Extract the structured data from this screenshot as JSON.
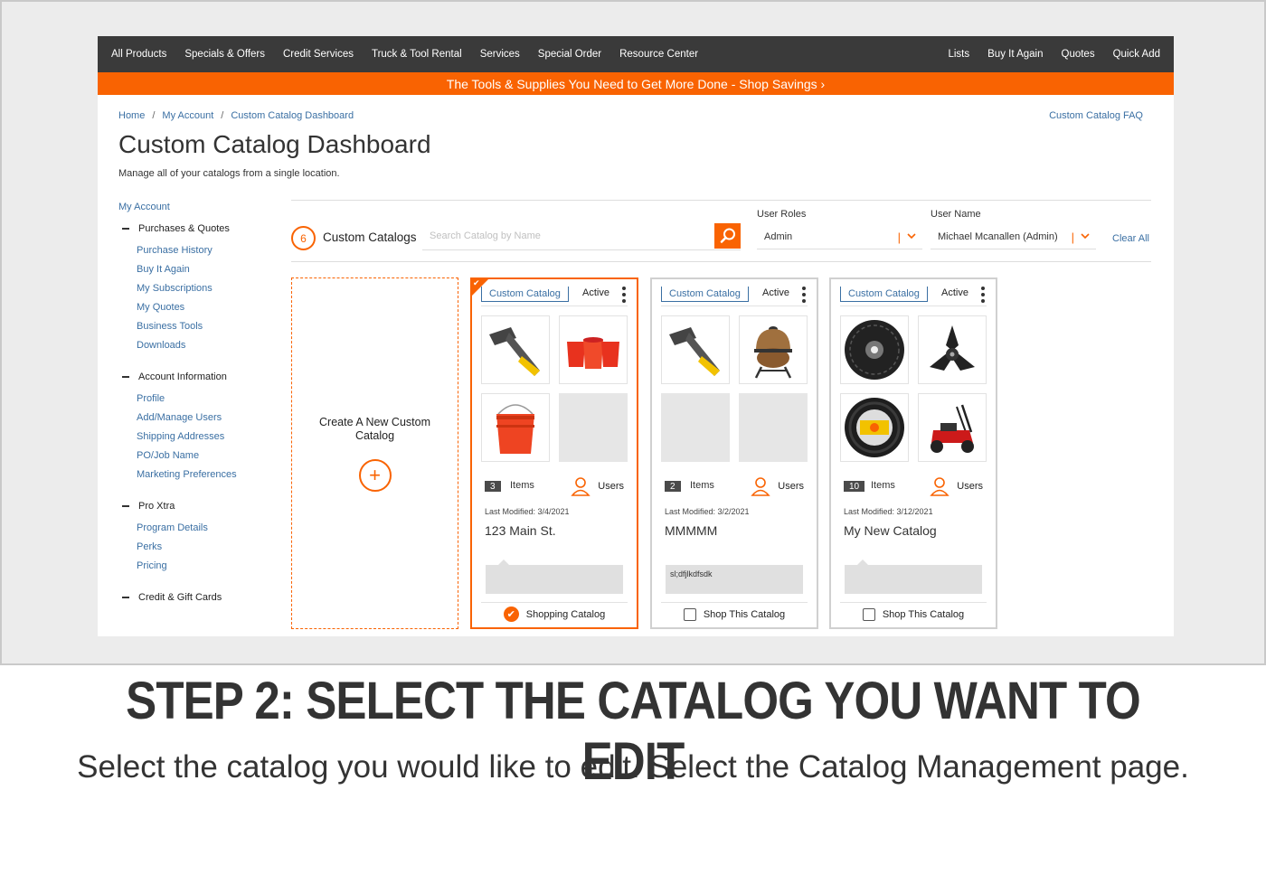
{
  "nav": {
    "left": [
      "All Products",
      "Specials & Offers",
      "Credit Services",
      "Truck & Tool Rental",
      "Services",
      "Special Order",
      "Resource Center"
    ],
    "right": [
      "Lists",
      "Buy It Again",
      "Quotes",
      "Quick Add"
    ]
  },
  "promo": "The Tools & Supplies You Need to Get More Done - Shop Savings ›",
  "breadcrumb": [
    "Home",
    "My Account",
    "Custom Catalog Dashboard"
  ],
  "faq_link": "Custom Catalog FAQ",
  "page": {
    "title": "Custom Catalog Dashboard",
    "subtitle": "Manage all of your catalogs from a single location."
  },
  "sidebar": {
    "account": "My Account",
    "sections": [
      {
        "title": "Purchases & Quotes",
        "links": [
          "Purchase History",
          "Buy It Again",
          "My Subscriptions",
          "My Quotes",
          "Business Tools",
          "Downloads"
        ]
      },
      {
        "title": "Account Information",
        "links": [
          "Profile",
          "Add/Manage Users",
          "Shipping Addresses",
          "PO/Job Name",
          "Marketing Preferences"
        ]
      },
      {
        "title": "Pro Xtra",
        "links": [
          "Program Details",
          "Perks",
          "Pricing"
        ]
      },
      {
        "title": "Credit & Gift Cards",
        "links": []
      }
    ]
  },
  "filters": {
    "count": "6",
    "catalogs_label": "Custom Catalogs",
    "search_placeholder": "Search Catalog by Name",
    "roles_label": "User Roles",
    "roles_value": "Admin",
    "username_label": "User Name",
    "username_value": "Michael Mcanallen (Admin)",
    "clear_all": "Clear All"
  },
  "create_card": {
    "label": "Create A New Custom Catalog",
    "plus": "+"
  },
  "cards": [
    {
      "type": "Custom Catalog",
      "status": "Active",
      "items": "3",
      "items_label": "Items",
      "users_label": "Users",
      "modified": "Last Modified: 3/4/2021",
      "name": "123 Main St.",
      "description": "",
      "footer": "Shopping Catalog"
    },
    {
      "type": "Custom Catalog",
      "status": "Active",
      "items": "2",
      "items_label": "Items",
      "users_label": "Users",
      "modified": "Last Modified: 3/2/2021",
      "name": "MMMMM",
      "description": "sl;dfjlkdfsdk",
      "footer": "Shop This Catalog"
    },
    {
      "type": "Custom Catalog",
      "status": "Active",
      "items": "10",
      "items_label": "Items",
      "users_label": "Users",
      "modified": "Last Modified: 3/12/2021",
      "name": "My New Catalog",
      "description": "",
      "footer": "Shop This Catalog"
    }
  ],
  "step": {
    "title": "STEP 2: SELECT THE CATALOG YOU WANT TO EDIT",
    "description": "Select the catalog you would like to edit. Select the Catalog Management page."
  },
  "colors": {
    "accent": "#f96302",
    "nav": "#3a3a3a",
    "link": "#3a6fa3"
  },
  "icons": [
    "search-icon",
    "chevron-down-icon",
    "plus-icon",
    "user-icon",
    "kebab-menu-icon",
    "checkmark-icon",
    "checkbox-icon"
  ]
}
